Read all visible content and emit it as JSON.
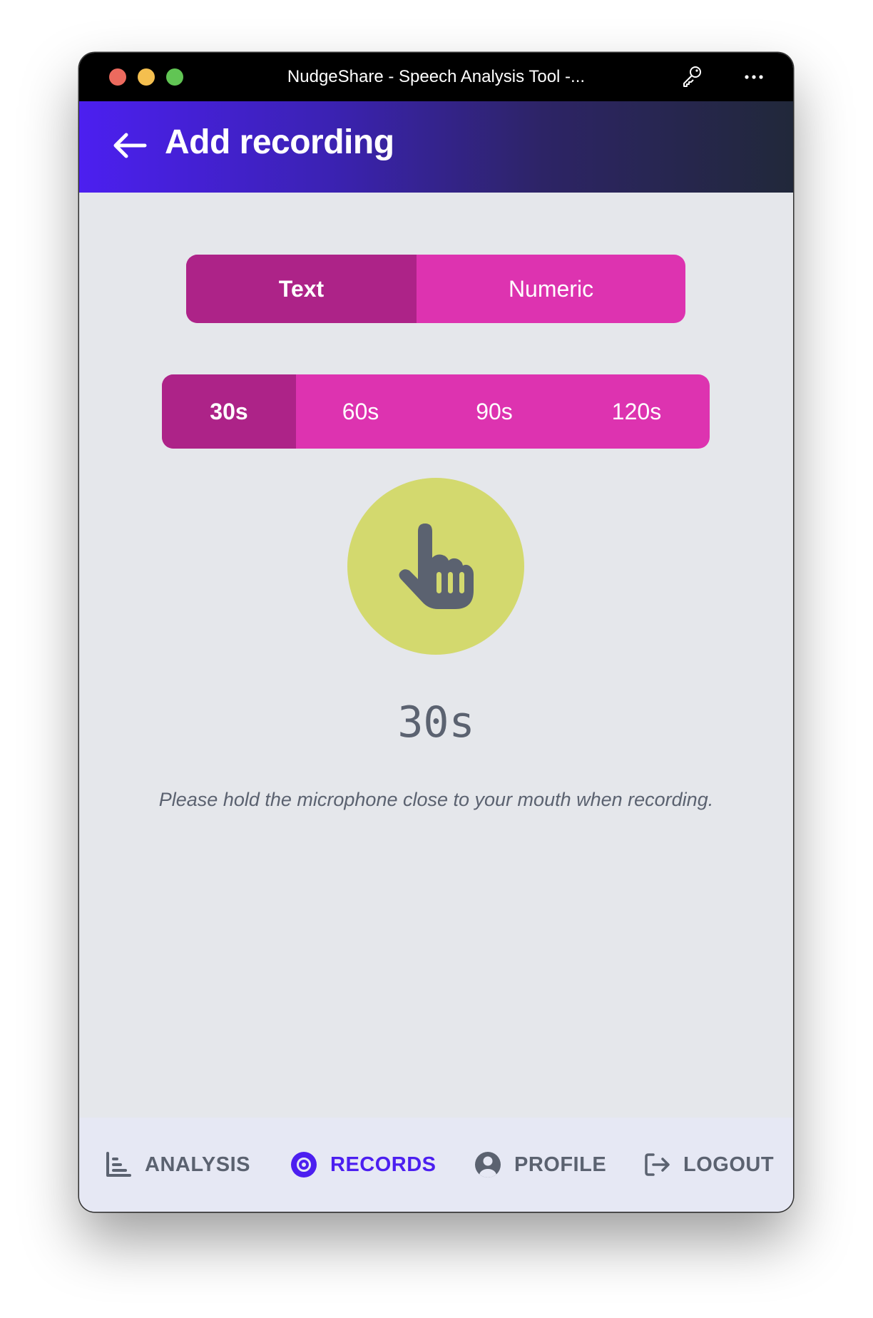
{
  "window": {
    "title": "NudgeShare - Speech Analysis Tool -..."
  },
  "header": {
    "title": "Add recording",
    "back_icon": "arrow-left-icon"
  },
  "mode_selector": {
    "options": [
      {
        "label": "Text",
        "active": true
      },
      {
        "label": "Numeric",
        "active": false
      }
    ]
  },
  "duration_selector": {
    "options": [
      {
        "label": "30s",
        "active": true
      },
      {
        "label": "60s",
        "active": false
      },
      {
        "label": "90s",
        "active": false
      },
      {
        "label": "120s",
        "active": false
      }
    ]
  },
  "record_button": {
    "icon": "hand-pointer-icon"
  },
  "timer": {
    "value": "30s"
  },
  "hint": "Please hold the microphone close to your mouth when recording.",
  "bottom_nav": {
    "items": [
      {
        "label": "ANALYSIS",
        "icon": "chart-icon",
        "active": false
      },
      {
        "label": "RECORDS",
        "icon": "record-icon",
        "active": true
      },
      {
        "label": "PROFILE",
        "icon": "user-circle-icon",
        "active": false
      },
      {
        "label": "LOGOUT",
        "icon": "logout-icon",
        "active": false
      }
    ]
  },
  "colors": {
    "accent": "#4c1ff0",
    "segment_bg": "#dd33b0",
    "segment_active": "#ad2388",
    "record_button": "#d3d96e",
    "muted_text": "#5b6270"
  }
}
